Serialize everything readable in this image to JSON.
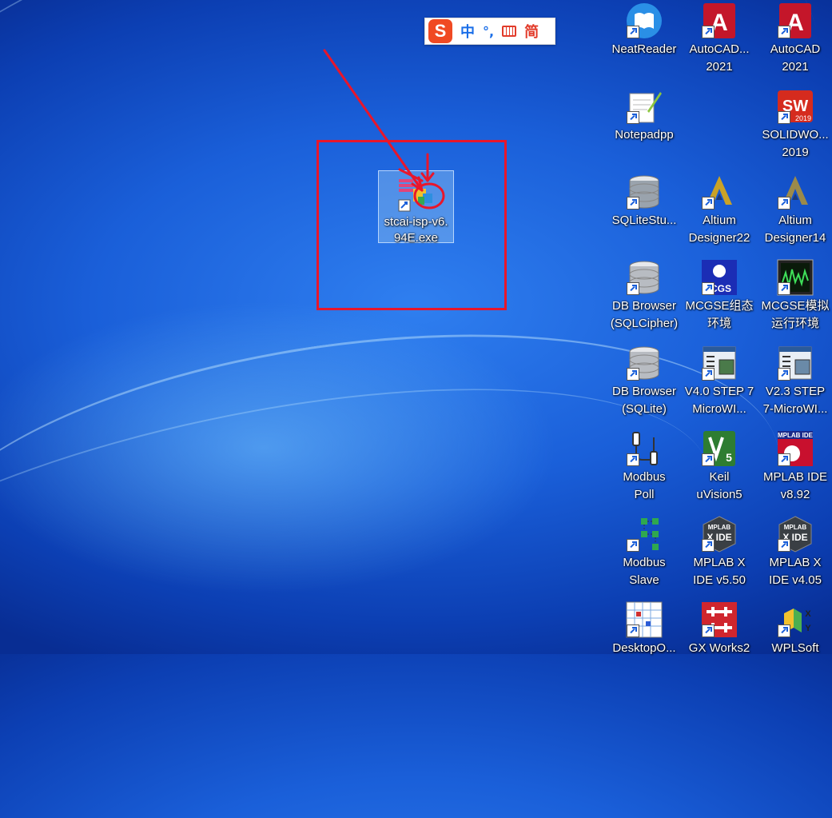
{
  "ime": {
    "logo": "S",
    "mode": "中",
    "punct": "°,",
    "keyboard_icon": "keyboard-icon",
    "variant": "简"
  },
  "selected_file": {
    "label_line1": "stcai-isp-v6.",
    "label_line2": "94E.exe",
    "icon": "stc-isp-app-icon"
  },
  "desktop_icons": [
    {
      "line1": "NeatReader",
      "line2": "",
      "icon": "neatreader-icon",
      "color": "#2a8fe6"
    },
    {
      "line1": "AutoCAD...",
      "line2": "2021",
      "icon": "autocad-icon",
      "color": "#c4162a"
    },
    {
      "line1": "AutoCAD",
      "line2": "2021",
      "icon": "autocad-icon",
      "color": "#c4162a"
    },
    {
      "line1": "Notepadpp",
      "line2": "",
      "icon": "notepadpp-icon",
      "color": "#8cc63f"
    },
    {
      "line1": "SOLIDWO...",
      "line2": "2019",
      "icon": "solidworks-icon",
      "color": "#d52b1e"
    },
    {
      "line1": "SQLiteStu...",
      "line2": "",
      "icon": "sqlite-studio-icon",
      "color": "#9aa3ad"
    },
    {
      "line1": "Altium",
      "line2": "Designer22",
      "icon": "altium-icon",
      "color": "#c9a227"
    },
    {
      "line1": "Altium",
      "line2": "Designer14",
      "icon": "altium-icon",
      "color": "#9b8a4a"
    },
    {
      "line1": "DB Browser",
      "line2": "(SQLCipher)",
      "icon": "database-icon",
      "color": "#b8bcc2"
    },
    {
      "line1": "MCGSE组态",
      "line2": "环境",
      "icon": "mcgse-icon",
      "color": "#1b2db5"
    },
    {
      "line1": "MCGSE模拟",
      "line2": "运行环境",
      "icon": "mcgse-sim-icon",
      "color": "#1d7a2a"
    },
    {
      "line1": "DB Browser",
      "line2": "(SQLite)",
      "icon": "database-icon",
      "color": "#b8bcc2"
    },
    {
      "line1": "V4.0 STEP 7",
      "line2": "MicroWI...",
      "icon": "step7-icon",
      "color": "#4a7a4a"
    },
    {
      "line1": "V2.3 STEP",
      "line2": "7-MicroWI...",
      "icon": "step7-icon",
      "color": "#6a8aa8"
    },
    {
      "line1": "Modbus",
      "line2": "Poll",
      "icon": "modbus-poll-icon",
      "color": "#333333"
    },
    {
      "line1": "Keil",
      "line2": "uVision5",
      "icon": "keil-icon",
      "color": "#2e7d32"
    },
    {
      "line1": "MPLAB IDE",
      "line2": "v8.92",
      "icon": "mplab-ide-icon",
      "color": "#c8102e"
    },
    {
      "line1": "Modbus",
      "line2": "Slave",
      "icon": "modbus-slave-icon",
      "color": "#2fa84f"
    },
    {
      "line1": "MPLAB X",
      "line2": "IDE v5.50",
      "icon": "mplab-x-icon",
      "color": "#3a3f44"
    },
    {
      "line1": "MPLAB X",
      "line2": "IDE v4.05",
      "icon": "mplab-x-icon",
      "color": "#3a3f44"
    },
    {
      "line1": "DesktopO...",
      "line2": "",
      "icon": "desktop-ok-icon",
      "color": "#d03030"
    },
    {
      "line1": "GX Works2",
      "line2": "",
      "icon": "gx-works-icon",
      "color": "#d0262e"
    },
    {
      "line1": "WPLSoft",
      "line2": "",
      "icon": "wplsoft-icon",
      "color": "#4caf50"
    }
  ],
  "annotation_color": "#e8162b"
}
